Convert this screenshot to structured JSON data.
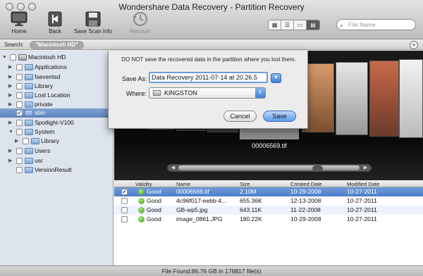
{
  "window": {
    "title": "Wondershare Data Recovery - Partition Recovery"
  },
  "toolbar": {
    "home_label": "Home",
    "back_label": "Back",
    "save_scan_label": "Save Scan Info",
    "recover_label": "Recover",
    "search_placeholder": "File Name"
  },
  "searchbar": {
    "label": "Search:",
    "token": "\"Macintosh HD\""
  },
  "sidebar": {
    "items": [
      {
        "label": "Macintosh HD",
        "icon": "disk-icon"
      },
      {
        "label": "Applications"
      },
      {
        "label": "fseventsd"
      },
      {
        "label": "Library"
      },
      {
        "label": "Lost Location"
      },
      {
        "label": "private"
      },
      {
        "label": "sbin",
        "checked": true,
        "selected": true
      },
      {
        "label": "Spotlight-V100"
      },
      {
        "label": "System"
      },
      {
        "label": "Library"
      },
      {
        "label": "Users"
      },
      {
        "label": "usr"
      },
      {
        "label": "VersionResult"
      }
    ]
  },
  "preview": {
    "filename": "00006569.tif"
  },
  "table": {
    "headers": [
      "Validity",
      "Name",
      "Size",
      "Created Date",
      "Modified Date"
    ],
    "rows": [
      {
        "checked": true,
        "validity": "Good",
        "name": "00006569.tif",
        "size": "2.10M",
        "created": "10-29-2008",
        "modified": "10-27-2011"
      },
      {
        "checked": false,
        "validity": "Good",
        "name": "4c96f017-eebb-4...",
        "size": "655.36K",
        "created": "12-13-2008",
        "modified": "10-27-2011"
      },
      {
        "checked": false,
        "validity": "Good",
        "name": "GB-wp5.jpg",
        "size": "643.11K",
        "created": "11-22-2008",
        "modified": "10-27-2011"
      },
      {
        "checked": false,
        "validity": "Good",
        "name": "image_0861.JPG",
        "size": "180.22K",
        "created": "10-29-2008",
        "modified": "10-27-2011"
      }
    ]
  },
  "status": {
    "text": "File Found:86.76 GB in 178817 file(s)"
  },
  "dialog": {
    "message": "DO NOT save the recovered data in the partition where you lost them.",
    "save_as_label": "Save As:",
    "save_as_value": "Data Recovery 2011-07-14 at 20.26.5",
    "where_label": "Where:",
    "where_value": "KINGSTON",
    "cancel_label": "Cancel",
    "save_label": "Save"
  },
  "colors": {
    "selection": "#5a82bd",
    "accent": "#3f7fd8",
    "valid_green": "#3c9c1e"
  }
}
